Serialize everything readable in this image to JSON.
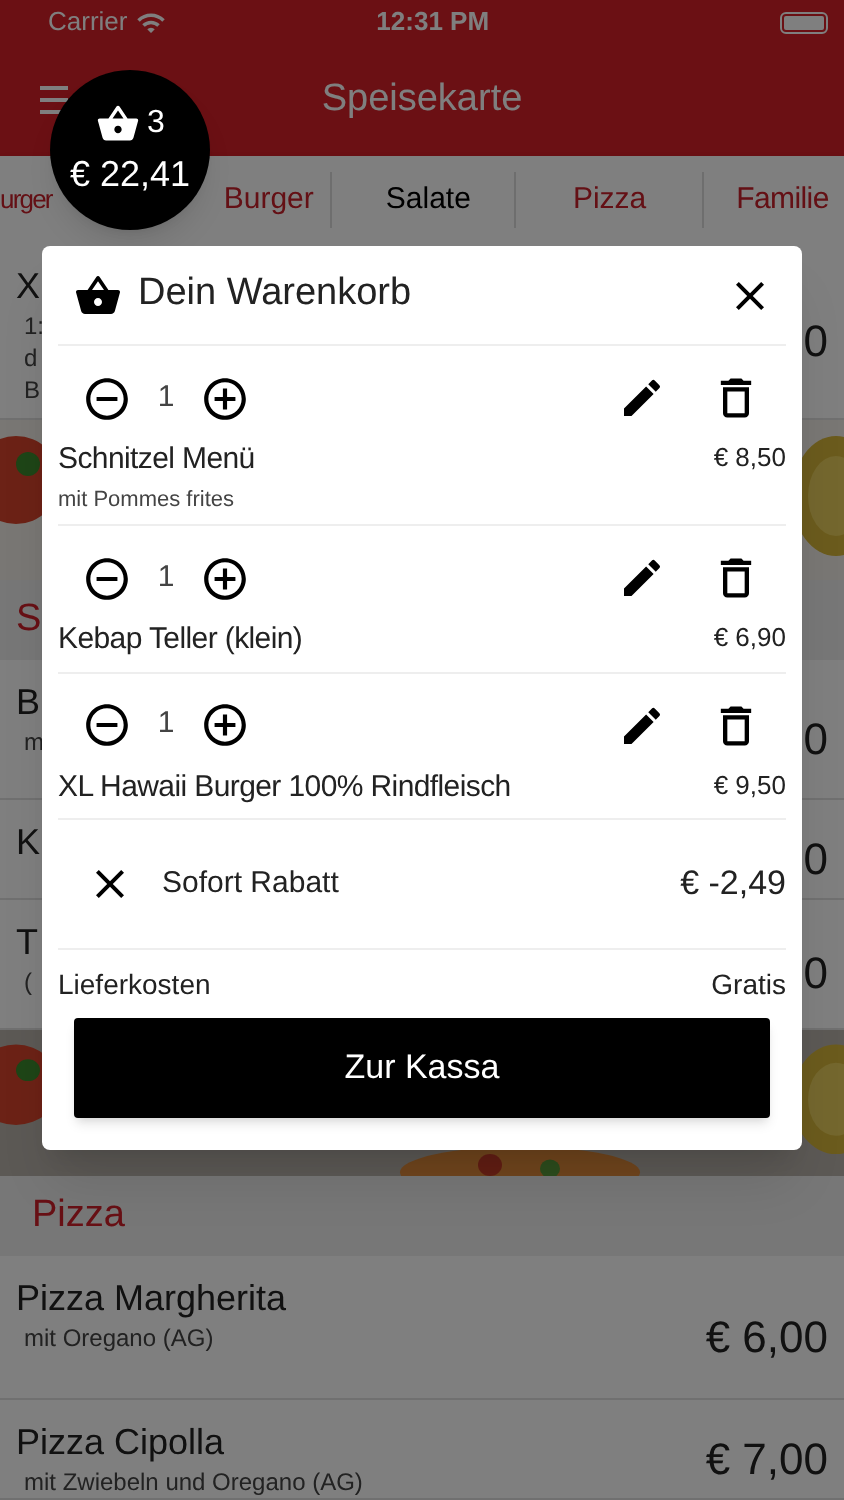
{
  "status_bar": {
    "carrier": "Carrier",
    "time": "12:31 PM"
  },
  "header": {
    "title": "Speisekarte"
  },
  "cart_badge": {
    "count": "3",
    "total": "€ 22,41"
  },
  "tabs": [
    {
      "label": "urger",
      "selected": false
    },
    {
      "label": "Burger",
      "selected": false
    },
    {
      "label": "Salate",
      "selected": true
    },
    {
      "label": "Pizza",
      "selected": false
    },
    {
      "label": "Familie",
      "selected": false
    }
  ],
  "menu": [
    {
      "kind": "item",
      "title": "X",
      "lines": [
        "1:",
        "d",
        "B"
      ],
      "price": "0"
    },
    {
      "kind": "picture"
    },
    {
      "kind": "section",
      "title": "S"
    },
    {
      "kind": "item",
      "title": "B",
      "lines": [
        "m"
      ],
      "price": "0"
    },
    {
      "kind": "item",
      "title": "K",
      "price": "0"
    },
    {
      "kind": "item",
      "title": "T",
      "lines": [
        "("
      ],
      "price": "0"
    },
    {
      "kind": "picture"
    },
    {
      "kind": "section",
      "title": "Pizza"
    },
    {
      "kind": "item",
      "title": "Pizza Margherita",
      "lines": [
        "mit Oregano (AG)"
      ],
      "price": "€ 6,00"
    },
    {
      "kind": "item",
      "title": "Pizza Cipolla",
      "lines": [
        "mit Zwiebeln und Oregano (AG)"
      ],
      "price": "€ 7,00"
    }
  ],
  "cart": {
    "title": "Dein Warenkorb",
    "items": [
      {
        "quantity": "1",
        "name": "Schnitzel Menü",
        "note": "mit Pommes frites",
        "price": "€ 8,50"
      },
      {
        "quantity": "1",
        "name": "Kebap Teller (klein)",
        "price": "€ 6,90"
      },
      {
        "quantity": "1",
        "name": "XL Hawaii Burger 100% Rindfleisch",
        "price": "€ 9,50"
      }
    ],
    "discount": {
      "label": "Sofort Rabatt",
      "amount": "€ -2,49"
    },
    "delivery": {
      "label": "Lieferkosten",
      "value": "Gratis"
    },
    "checkout_button": "Zur Kassa"
  }
}
